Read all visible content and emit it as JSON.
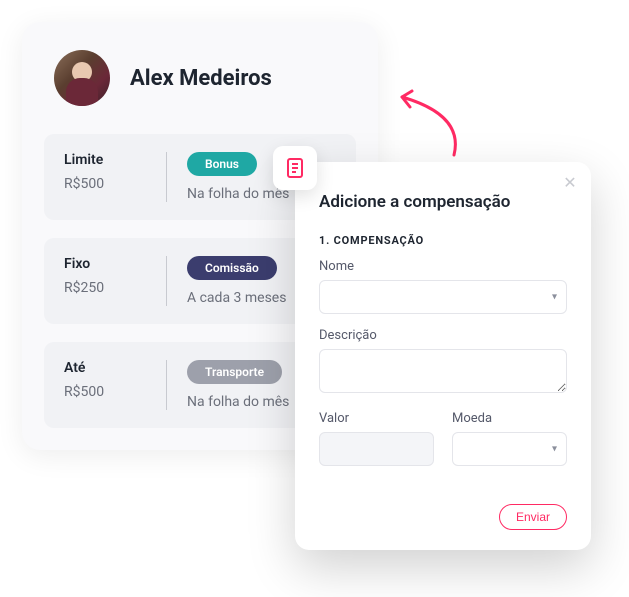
{
  "profile": {
    "name": "Alex Medeiros"
  },
  "rows": [
    {
      "left_label": "Limite",
      "left_value": "R$500",
      "badge": "Bonus",
      "badge_class": "badge-teal",
      "sub": "Na folha do mês"
    },
    {
      "left_label": "Fixo",
      "left_value": "R$250",
      "badge": "Comissão",
      "badge_class": "badge-navy",
      "sub": "A cada 3 meses"
    },
    {
      "left_label": "Até",
      "left_value": "R$500",
      "badge": "Transporte",
      "badge_class": "badge-grey",
      "sub": "Na folha do mês"
    }
  ],
  "modal": {
    "title": "Adicione a compensação",
    "step": "1. COMPENSAÇÃO",
    "labels": {
      "name": "Nome",
      "desc": "Descrição",
      "value": "Valor",
      "currency": "Moeda"
    },
    "send": "Enviar"
  }
}
